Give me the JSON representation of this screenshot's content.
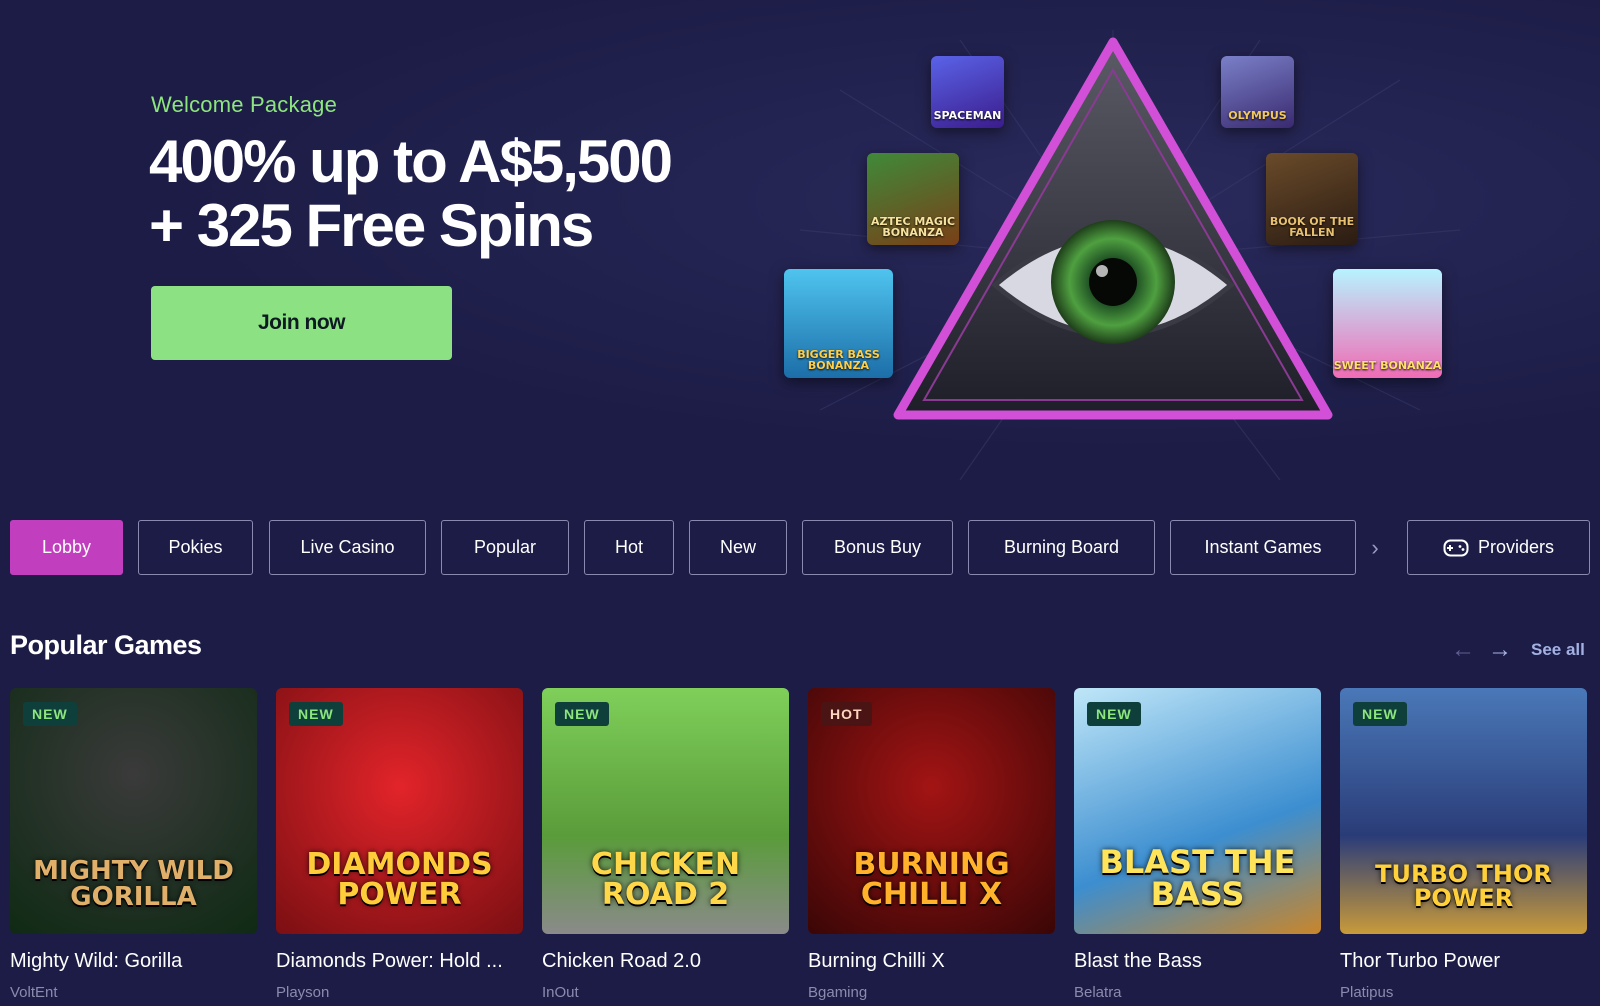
{
  "hero": {
    "eyebrow": "Welcome Package",
    "title_line1": "400% up to A$5,500",
    "title_line2": "+ 325 Free Spins",
    "cta_label": "Join now",
    "tiles": [
      {
        "label": "SPACEMAN"
      },
      {
        "label": "OLYMPUS"
      },
      {
        "label": "AZTEC MAGIC BONANZA"
      },
      {
        "label": "BOOK OF THE FALLEN"
      },
      {
        "label": "BIGGER BASS BONANZA"
      },
      {
        "label": "SWEET BONANZA"
      }
    ]
  },
  "tabs": [
    {
      "label": "Lobby",
      "active": true
    },
    {
      "label": "Pokies"
    },
    {
      "label": "Live Casino"
    },
    {
      "label": "Popular"
    },
    {
      "label": "Hot"
    },
    {
      "label": "New"
    },
    {
      "label": "Bonus Buy"
    },
    {
      "label": "Burning Board"
    },
    {
      "label": "Instant Games"
    }
  ],
  "providers_label": "Providers",
  "section": {
    "title": "Popular Games",
    "see_all": "See all"
  },
  "games": [
    {
      "badge": "NEW",
      "name": "Mighty Wild: Gorilla",
      "provider": "VoltEnt",
      "art": "MIGHTY WILD GORILLA"
    },
    {
      "badge": "NEW",
      "name": "Diamonds Power: Hold ...",
      "provider": "Playson",
      "art": "DIAMONDS POWER"
    },
    {
      "badge": "NEW",
      "name": "Chicken Road 2.0",
      "provider": "InOut",
      "art": "CHICKEN ROAD 2"
    },
    {
      "badge": "HOT",
      "name": "Burning Chilli X",
      "provider": "Bgaming",
      "art": "BURNING CHILLI X"
    },
    {
      "badge": "NEW",
      "name": "Blast the Bass",
      "provider": "Belatra",
      "art": "BLAST THE BASS"
    },
    {
      "badge": "NEW",
      "name": "Thor Turbo Power",
      "provider": "Platipus",
      "art": "TURBO THOR POWER"
    }
  ]
}
